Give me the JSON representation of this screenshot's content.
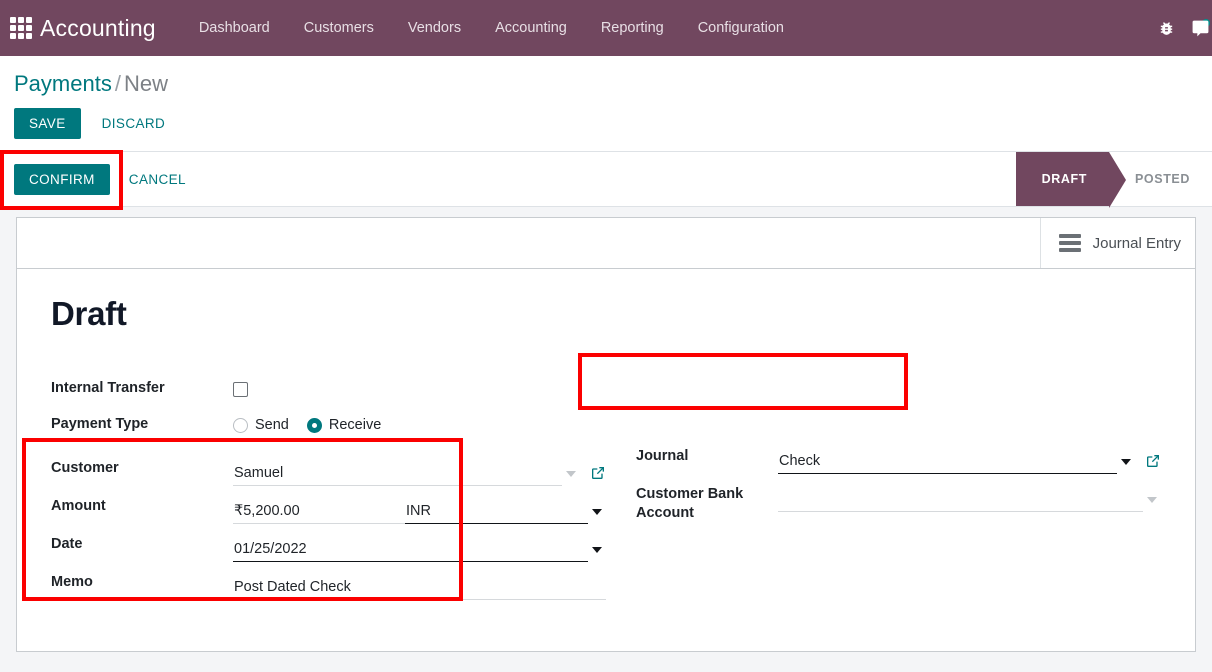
{
  "navbar": {
    "apps_icon": "apps-grid-icon",
    "brand": "Accounting",
    "menu": [
      {
        "label": "Dashboard"
      },
      {
        "label": "Customers"
      },
      {
        "label": "Vendors"
      },
      {
        "label": "Accounting"
      },
      {
        "label": "Reporting"
      },
      {
        "label": "Configuration"
      }
    ],
    "right_icons": [
      {
        "name": "bug-icon"
      },
      {
        "name": "chat-bubble-icon"
      }
    ],
    "bg_color": "#71475f"
  },
  "breadcrumb": {
    "parent": "Payments",
    "separator": "/",
    "current": "New"
  },
  "edit_buttons": {
    "save": "SAVE",
    "discard": "DISCARD"
  },
  "action_bar": {
    "confirm": "CONFIRM",
    "cancel": "CANCEL",
    "statuses": [
      {
        "label": "DRAFT",
        "active": true
      },
      {
        "label": "POSTED",
        "active": false
      }
    ]
  },
  "smart_buttons": [
    {
      "label": "Journal Entry",
      "icon": "bars-icon"
    }
  ],
  "form": {
    "title": "Draft",
    "left": {
      "internal_transfer": {
        "label": "Internal Transfer",
        "checked": false
      },
      "payment_type": {
        "label": "Payment Type",
        "options": [
          {
            "label": "Send",
            "selected": false
          },
          {
            "label": "Receive",
            "selected": true
          }
        ]
      },
      "customer": {
        "label": "Customer",
        "value": "Samuel"
      },
      "amount": {
        "label": "Amount",
        "value": "₹5,200.00",
        "currency": "INR"
      },
      "date": {
        "label": "Date",
        "value": "01/25/2022"
      },
      "memo": {
        "label": "Memo",
        "value": "Post Dated Check"
      }
    },
    "right": {
      "journal": {
        "label": "Journal",
        "value": "Check"
      },
      "customer_bank_account": {
        "label": "Customer Bank\nAccount",
        "label_line1": "Customer Bank",
        "label_line2": "Account",
        "value": ""
      }
    }
  },
  "colors": {
    "brand_purple": "#71475f",
    "accent_teal": "#00787e",
    "annotation_red": "#fb0000",
    "page_bg": "#f4f5f7"
  }
}
